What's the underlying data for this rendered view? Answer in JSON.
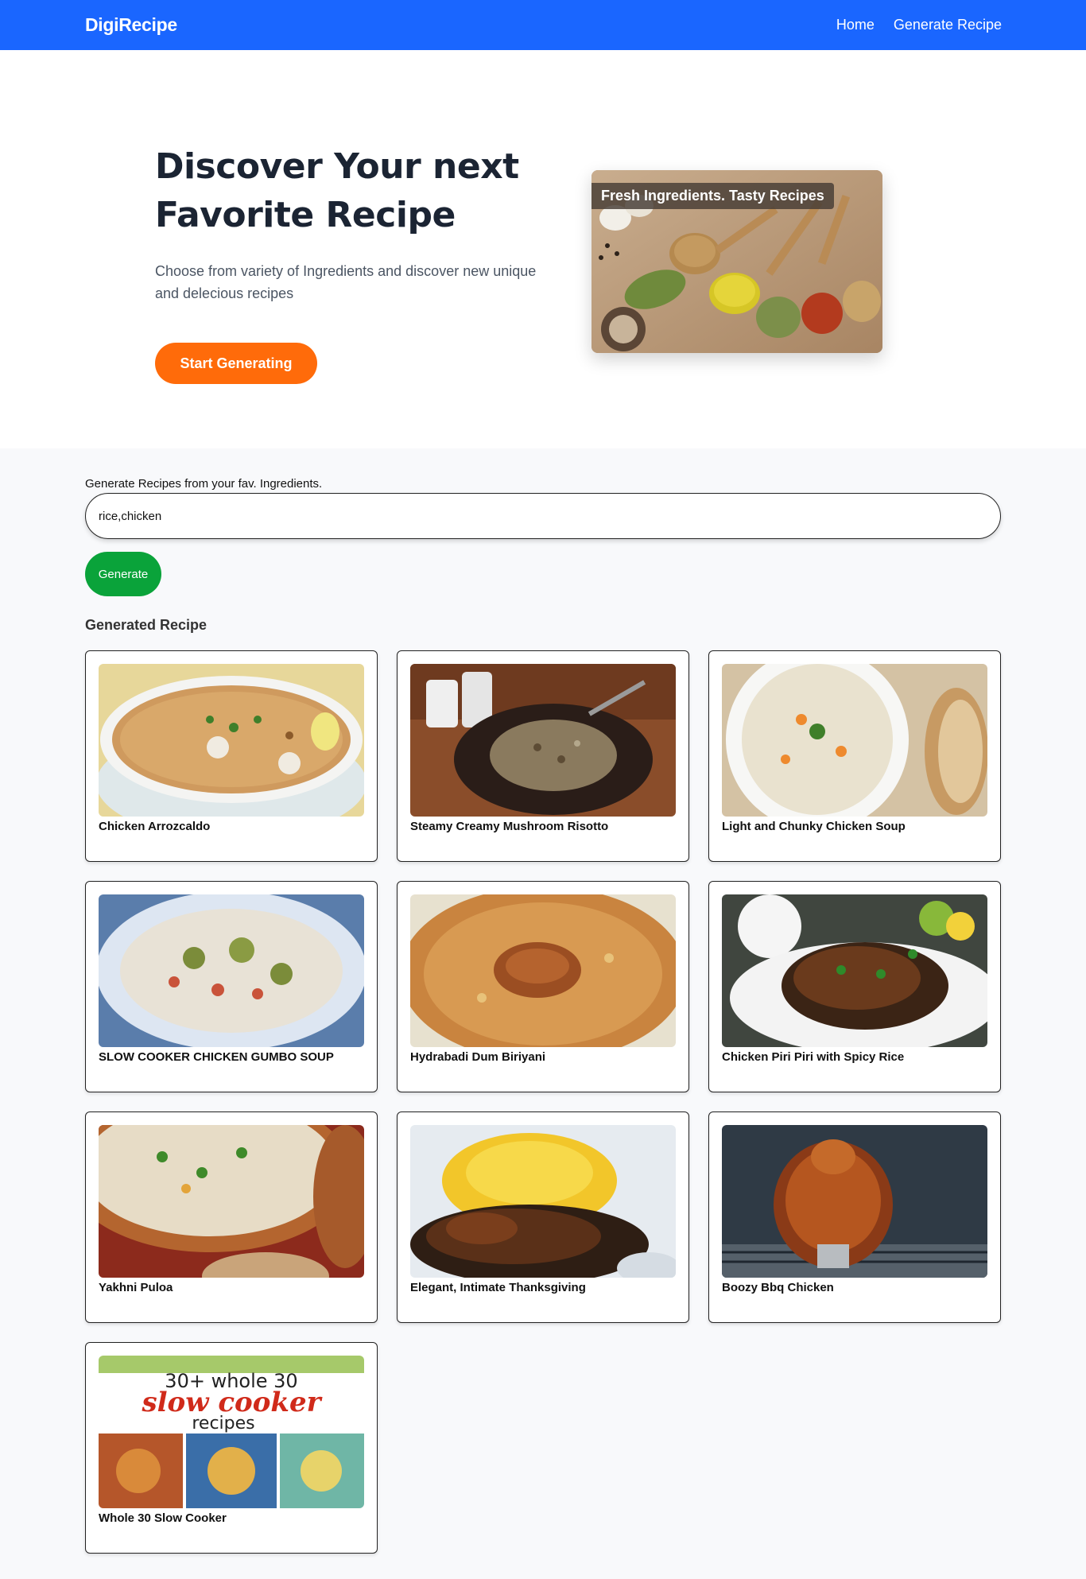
{
  "navbar": {
    "brand": "DigiRecipe",
    "links": [
      "Home",
      "Generate Recipe"
    ]
  },
  "hero": {
    "title": "Discover Your next Favorite Recipe",
    "subtitle": "Choose from variety of Ingredients and discover new unique and delecious recipes",
    "cta_label": "Start Generating",
    "image_caption": "Fresh Ingredients. Tasty Recipes"
  },
  "generator": {
    "label": "Generate Recipes from your fav. Ingredients.",
    "input_value": "rice,chicken",
    "button_label": "Generate",
    "results_heading": "Generated Recipe"
  },
  "recipes": [
    {
      "title": "Chicken Arrozcaldo"
    },
    {
      "title": "Steamy Creamy Mushroom Risotto"
    },
    {
      "title": "Light and Chunky Chicken Soup"
    },
    {
      "title": "SLOW COOKER CHICKEN GUMBO SOUP"
    },
    {
      "title": "Hydrabadi Dum Biriyani"
    },
    {
      "title": "Chicken Piri Piri with Spicy Rice"
    },
    {
      "title": "Yakhni Puloa"
    },
    {
      "title": "Elegant, Intimate Thanksgiving"
    },
    {
      "title": "Boozy Bbq Chicken"
    },
    {
      "title": "Whole 30 Slow Cooker",
      "image_text": [
        "30+ whole 30",
        "slow cooker",
        "recipes"
      ]
    }
  ],
  "colors": {
    "nav": "#1a66ff",
    "cta": "#ff6b0a",
    "generate": "#0aa33a"
  }
}
